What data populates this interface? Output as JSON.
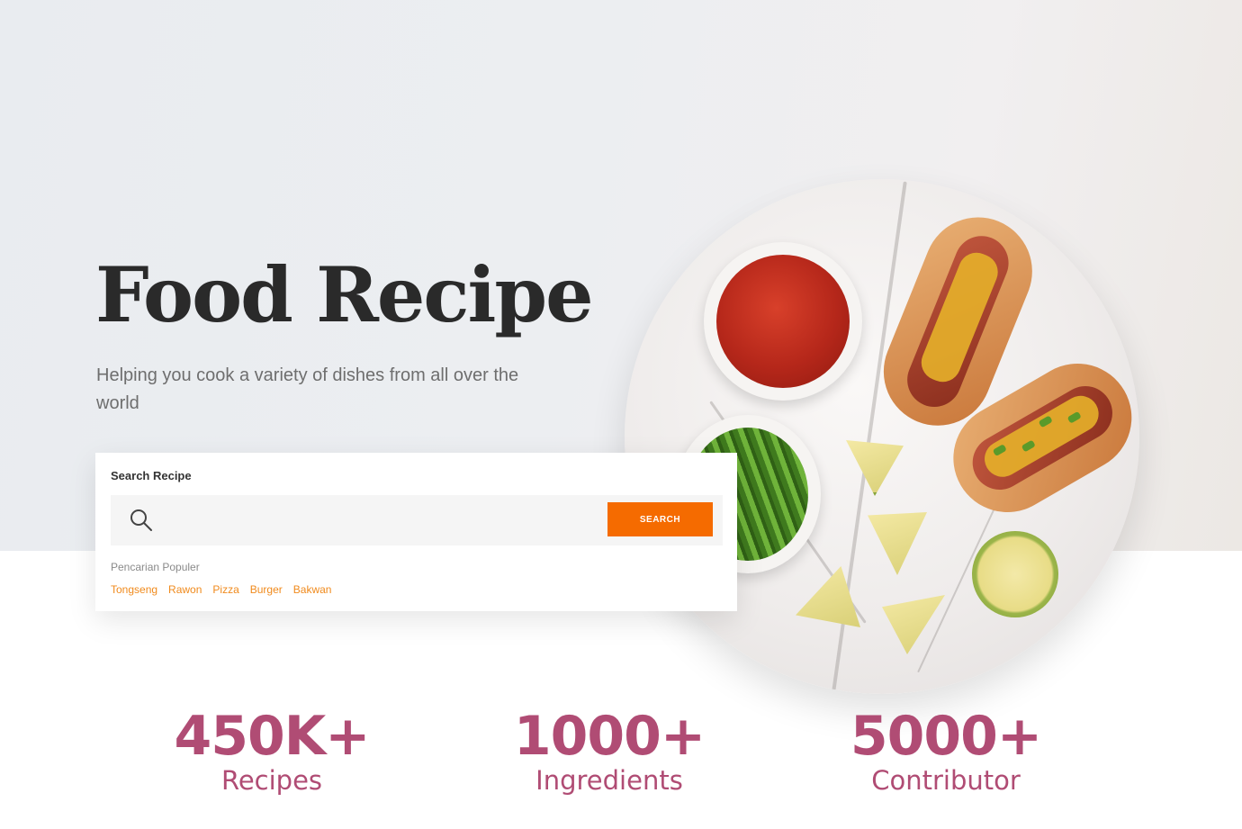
{
  "hero": {
    "title": "Food Recipe",
    "subtitle": "Helping you cook a variety of dishes from all over the world"
  },
  "search": {
    "label": "Search Recipe",
    "placeholder": "",
    "button_label": "SEARCH",
    "popular_label": "Pencarian Populer",
    "popular_tags": [
      "Tongseng",
      "Rawon",
      "Pizza",
      "Burger",
      "Bakwan"
    ]
  },
  "stats": [
    {
      "value": "450K+",
      "label": "Recipes"
    },
    {
      "value": "1000+",
      "label": "Ingredients"
    },
    {
      "value": "5000+",
      "label": "Contributor"
    }
  ],
  "colors": {
    "accent": "#f56b00",
    "tag": "#f08a1c",
    "stat": "#b04c74",
    "title": "#2a2a2a"
  },
  "icons": {
    "search": "search-icon"
  }
}
